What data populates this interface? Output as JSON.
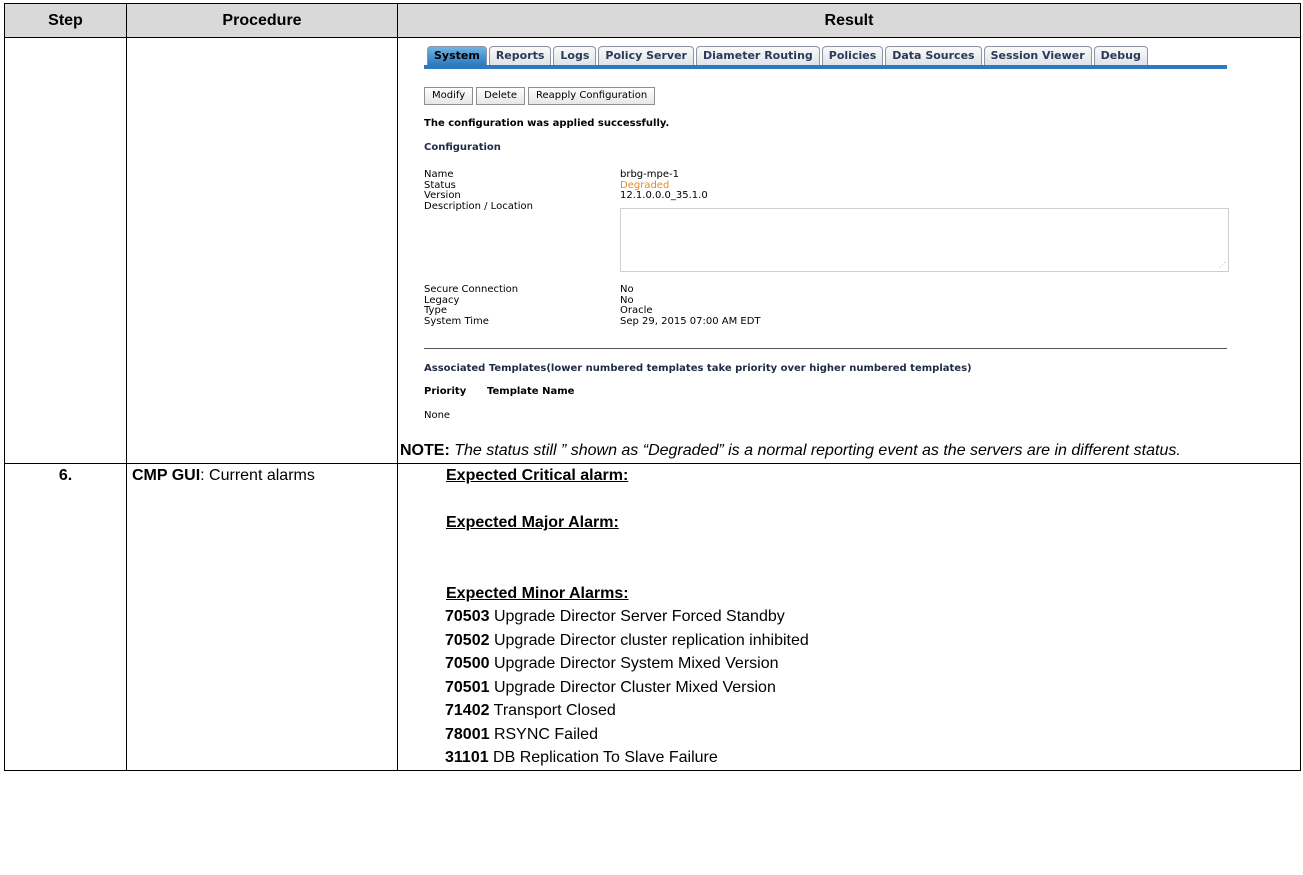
{
  "table": {
    "headers": {
      "step": "Step",
      "procedure": "Procedure",
      "result": "Result"
    }
  },
  "screenshot": {
    "tabs": [
      "System",
      "Reports",
      "Logs",
      "Policy Server",
      "Diameter Routing",
      "Policies",
      "Data Sources",
      "Session Viewer",
      "Debug"
    ],
    "active_tab": "System",
    "buttons": {
      "modify": "Modify",
      "delete": "Delete",
      "reapply": "Reapply Configuration"
    },
    "message": "The configuration was applied successfully.",
    "configuration_heading": "Configuration",
    "fields": {
      "name_label": "Name",
      "name_value": "brbg-mpe-1",
      "status_label": "Status",
      "status_value": "Degraded",
      "version_label": "Version",
      "version_value": "12.1.0.0.0_35.1.0",
      "description_label": "Description / Location",
      "secure_label": "Secure Connection",
      "secure_value": "No",
      "legacy_label": "Legacy",
      "legacy_value": "No",
      "type_label": "Type",
      "type_value": "Oracle",
      "time_label": "System Time",
      "time_value": "Sep 29, 2015 07:00 AM EDT"
    },
    "templates_heading": "Associated Templates(lower numbered templates take priority over higher numbered templates)",
    "priority_header": "Priority",
    "template_name_header": "Template Name",
    "templates_none": "None"
  },
  "note": {
    "label": "NOTE:",
    "text": "The status still ” shown as “Degraded” is a normal reporting event as the servers are in different status."
  },
  "step6": {
    "number": "6.",
    "procedure_bold": "CMP GUI",
    "procedure_rest": ": Current alarms",
    "critical_heading": "Expected Critical alarm:",
    "major_heading": "Expected Major Alarm:",
    "minor_heading": "Expected Minor Alarms:",
    "minor_alarms": [
      {
        "code": "70503",
        "text": " Upgrade Director Server Forced Standby"
      },
      {
        "code": "70502",
        "text": " Upgrade Director cluster replication inhibited"
      },
      {
        "code": "70500",
        "text": " Upgrade Director System Mixed Version"
      },
      {
        "code": "70501",
        "text": " Upgrade Director Cluster Mixed Version"
      },
      {
        "code": "71402",
        "text": " Transport Closed"
      },
      {
        "code": "78001",
        "text": " RSYNC Failed"
      },
      {
        "code": "31101",
        "text": " DB Replication To Slave Failure"
      }
    ]
  }
}
